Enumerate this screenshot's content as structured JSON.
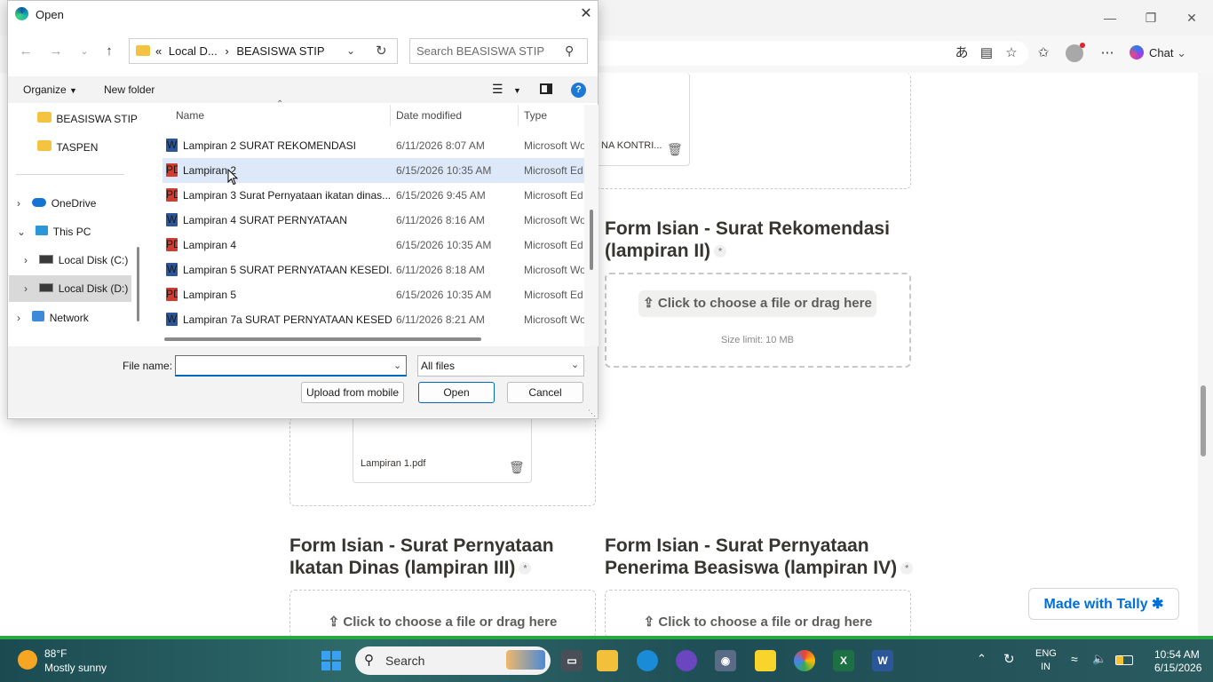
{
  "dialog": {
    "title": "Open",
    "breadcrumb": {
      "prefix": "«",
      "part1": "Local D...",
      "separator": "›",
      "part2": "BEASISWA STIP"
    },
    "search_placeholder": "Search BEASISWA STIP",
    "toolbar": {
      "organize": "Organize",
      "new_folder": "New folder"
    },
    "nav": {
      "beasiswa": "BEASISWA STIP",
      "taspen": "TASPEN",
      "onedrive": "OneDrive",
      "this_pc": "This PC",
      "local_c": "Local Disk (C:)",
      "local_d": "Local Disk (D:)",
      "network": "Network"
    },
    "columns": {
      "name": "Name",
      "date": "Date modified",
      "type": "Type"
    },
    "files": [
      {
        "name": "Lampiran 2 SURAT REKOMENDASI",
        "date": "6/11/2026 8:07 AM",
        "type": "Microsoft Wo",
        "icon": "word-doc-icon"
      },
      {
        "name": "Lampiran 2",
        "date": "6/15/2026 10:35 AM",
        "type": "Microsoft Ed",
        "icon": "pdf-icon"
      },
      {
        "name": "Lampiran 3 Surat Pernyataan ikatan dinas...",
        "date": "6/15/2026 9:45 AM",
        "type": "Microsoft Ed",
        "icon": "pdf-icon"
      },
      {
        "name": "Lampiran 4 SURAT PERNYATAAN",
        "date": "6/11/2026 8:16 AM",
        "type": "Microsoft Wo",
        "icon": "word-doc-icon"
      },
      {
        "name": "Lampiran 4",
        "date": "6/15/2026 10:35 AM",
        "type": "Microsoft Ed",
        "icon": "pdf-icon"
      },
      {
        "name": "Lampiran 5 SURAT PERNYATAAN KESEDI...",
        "date": "6/11/2026 8:18 AM",
        "type": "Microsoft Wo",
        "icon": "word-doc-icon"
      },
      {
        "name": "Lampiran 5",
        "date": "6/15/2026 10:35 AM",
        "type": "Microsoft Ed",
        "icon": "pdf-icon"
      },
      {
        "name": "Lampiran 7a SURAT PERNYATAAN KESED...",
        "date": "6/11/2026 8:21 AM",
        "type": "Microsoft Wo",
        "icon": "word-doc-icon"
      }
    ],
    "selected_file": "Lampiran 2",
    "file_name_label": "File name:",
    "file_name_value": "",
    "file_type": "All files",
    "buttons": {
      "upload": "Upload from mobile",
      "open": "Open",
      "cancel": "Cancel"
    }
  },
  "browser": {
    "chat_label": "Chat"
  },
  "page": {
    "partial_file_card": "NA KONTRI...",
    "form2_title": "Form Isian - Surat Rekomendasi (lampiran II)",
    "form2_title_line1": "Form Isian - Surat Rekomendasi",
    "form2_title_line2": "(lampiran II)",
    "choose_file": "Click to choose a file or drag here",
    "size_limit": "Size limit: 10 MB",
    "uploaded_file": "Lampiran 1.pdf",
    "form3_title_line1": "Form Isian - Surat Pernyataan",
    "form3_title_line2": "Ikatan Dinas (lampiran III)",
    "form4_title_line1": "Form Isian - Surat Pernyataan",
    "form4_title_line2": "Penerima Beasiswa (lampiran IV)",
    "made_with": "Made with Tally",
    "required_mark": "*"
  },
  "taskbar": {
    "temperature": "88°F",
    "weather": "Mostly sunny",
    "search": "Search",
    "lang1": "ENG",
    "lang2": "IN",
    "time": "10:54 AM",
    "date": "6/15/2026"
  },
  "colors": {
    "accent": "#0067c0",
    "tally_blue": "#0070d7",
    "selection": "#dde9f8"
  }
}
